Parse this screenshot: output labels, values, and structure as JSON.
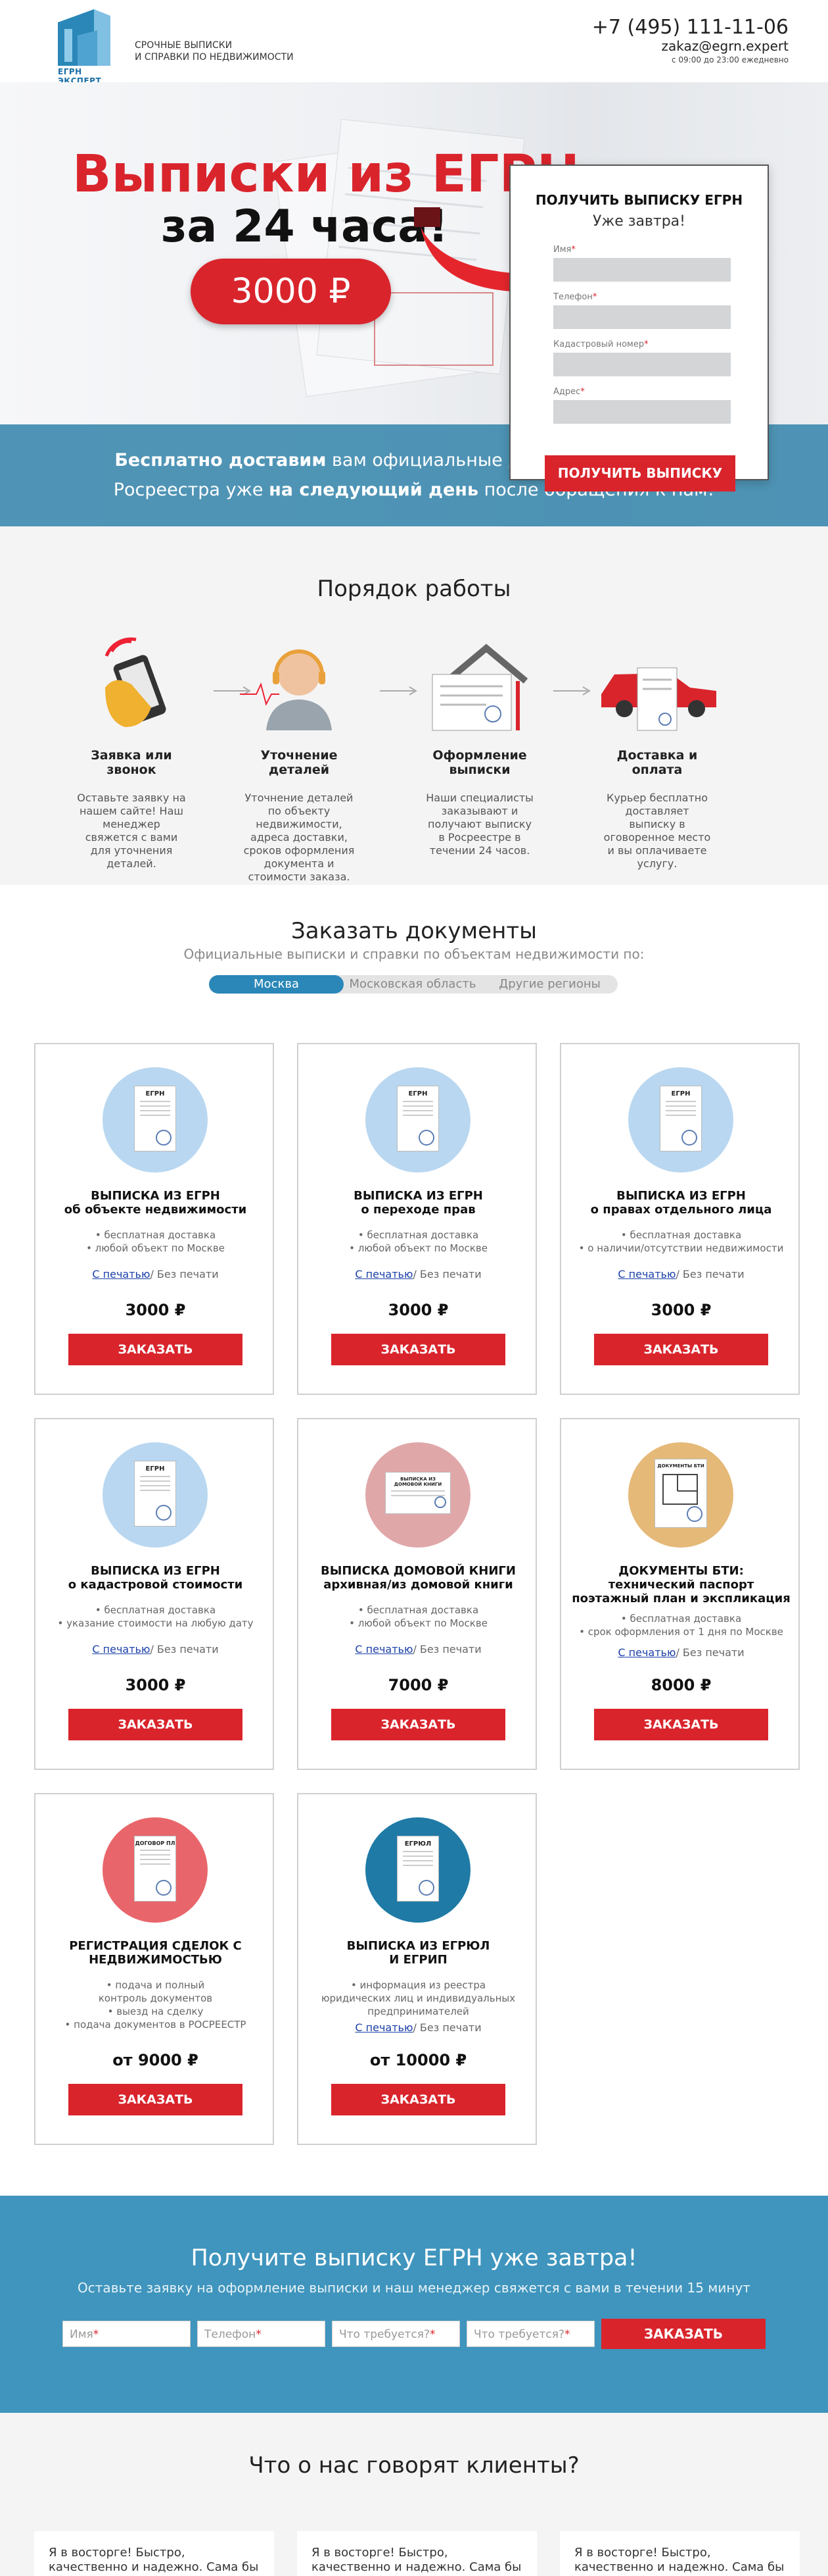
{
  "header": {
    "logo_text": "ЕГРН ЭКСПЕРТ",
    "tagline_line1": "Срочные выписки",
    "tagline_line2": "и справки по недвижимости",
    "phone": "+7 (495) 111-11-06",
    "email": "zakaz@egrn.expert",
    "hours": "с 09:00 до 23:00 ежедневно"
  },
  "hero": {
    "title_line1": "Выписки из  ЕГРН",
    "title_line2": "за 24 часа!",
    "price": "3000 ₽",
    "band_part1": "Бесплатно доставим",
    "band_part2": " вам официальные документы  с печатью Росреестра уже ",
    "band_part3": "на следующий день",
    "band_part4": " после обращения к нам!"
  },
  "form": {
    "title": "ПОЛУЧИТЬ ВЫПИСКУ ЕГРН",
    "subtitle": "Уже завтра!",
    "fields": [
      {
        "label": "Имя"
      },
      {
        "label": "Телефон"
      },
      {
        "label": "Кадастровый номер"
      },
      {
        "label": "Адрес"
      }
    ],
    "submit": "ПОЛУЧИТЬ ВЫПИСКУ"
  },
  "process": {
    "title": "Порядок работы",
    "steps": [
      {
        "title": "Заявка или звонок",
        "text": "Оставьте заявку на нашем сайте! Наш менеджер свяжется с вами для уточнения деталей.",
        "icon": "phone-hand-icon"
      },
      {
        "title": "Уточнение деталей",
        "text": "Уточнение деталей по объекту недвижимости, адреса доставки, сроков оформления документа и стоимости заказа.",
        "icon": "headset-operator-icon"
      },
      {
        "title": "Оформление выписки",
        "text": "Наши специалисты заказывают и получают выписку  в Росреестре в течении 24 часов.",
        "icon": "house-document-icon"
      },
      {
        "title": "Доставка и оплата",
        "text": "Курьер бесплатно доставляет выписку в оговоренное место и вы оплачиваете услугу.",
        "icon": "car-document-icon"
      }
    ]
  },
  "order": {
    "title": "Заказать документы",
    "subtitle": "Официальные выписки и справки по объектам недвижимости по:",
    "tabs": [
      "Москва",
      "Московская область",
      "Другие регионы"
    ],
    "print_link": "С печатью",
    "print_rest": "/ Без печати",
    "button": "ЗАКАЗАТЬ",
    "cards": [
      {
        "title1": "ВЫПИСКА ИЗ ЕГРН",
        "title2": "об объекте недвижимости",
        "items": [
          "• бесплатная доставка",
          "• любой объект по Москве"
        ],
        "price": "3000 ₽",
        "doc": "ЕГРН",
        "color": "#b9d7f0"
      },
      {
        "title1": "ВЫПИСКА ИЗ ЕГРН",
        "title2": "о переходе прав",
        "items": [
          "• бесплатная доставка",
          "• любой объект по Москве"
        ],
        "price": "3000 ₽",
        "doc": "ЕГРН",
        "color": "#b9d7f0"
      },
      {
        "title1": "ВЫПИСКА ИЗ ЕГРН",
        "title2": "о правах отдельного лица",
        "items": [
          "• бесплатная доставка",
          "• о наличии/отсутствии недвижимости"
        ],
        "price": "3000 ₽",
        "doc": "ЕГРН",
        "color": "#b9d7f0"
      },
      {
        "title1": "ВЫПИСКА ИЗ ЕГРН",
        "title2": "о кадастровой стоимости",
        "items": [
          "• бесплатная доставка",
          "• указание стоимости на любую дату"
        ],
        "price": "3000 ₽",
        "doc": "ЕГРН",
        "color": "#b9d7f0"
      },
      {
        "title1": "ВЫПИСКА ДОМОВОЙ КНИГИ",
        "title2": "архивная/из домовой книги",
        "items": [
          "• бесплатная доставка",
          "• любой объект по Москве"
        ],
        "price": "7000 ₽",
        "doc": "ВЫПИСКА ИЗ ДОМОВОЙ КНИГИ",
        "color": "#e0a7a9"
      },
      {
        "title1": "ДОКУМЕНТЫ БТИ:",
        "title2": "технический паспорт",
        "title3": "поэтажный план и экспликация",
        "items": [
          "• бесплатная доставка",
          "• срок оформления от 1 дня по Москве"
        ],
        "price": "8000 ₽",
        "doc": "ДОКУМЕНТЫ БТИ",
        "color": "#e5b978"
      },
      {
        "title1": "РЕГИСТРАЦИЯ СДЕЛОК С",
        "title2": "НЕДВИЖИМОСТЬЮ",
        "items": [
          "• подача и полный",
          "контроль документов",
          "• выезд на сделку",
          "• подача документов в РОСРЕЕСТР"
        ],
        "price": "от 9000 ₽",
        "doc": "ДОГОВОР ПЛ",
        "color": "#e8666b"
      },
      {
        "title1": "ВЫПИСКА ИЗ ЕГРЮЛ",
        "title2": "И ЕГРИП",
        "items": [
          "• информация из реестра",
          "юридических лиц и индивидуальных",
          "предпринимателей"
        ],
        "price": "от 10000 ₽",
        "doc": "ЕГРЮЛ",
        "color": "#1f7aa6"
      }
    ]
  },
  "cta": {
    "title": "Получите выписку  ЕГРН уже завтра!",
    "subtitle": "Оставьте заявку на оформление выписки и наш менеджер свяжется с вами в течении 15 минут",
    "fields": [
      "Имя",
      "Телефон",
      "Что требуется?",
      "Что требуется?"
    ],
    "submit": "ЗАКАЗАТЬ"
  },
  "reviews": {
    "title": "Что о нас говорят клиенты?",
    "items": [
      "Я в восторге! Быстро, качественно и надежно. Сама бы я врятли успела бы оформить все документы. Спасибо!",
      "Я в восторге! Быстро, качественно и надежно. Сама бы я врятли успела бы оформить все документы. Спасибо!",
      "Я в восторге! Быстро, качественно и надежно. Сама бы я врятли успела бы оформить все документы. Спасибо!"
    ]
  },
  "colors": {
    "accent_red": "#d9242c",
    "brand_blue": "#2a87b8",
    "cta_blue": "#3f95bd"
  }
}
